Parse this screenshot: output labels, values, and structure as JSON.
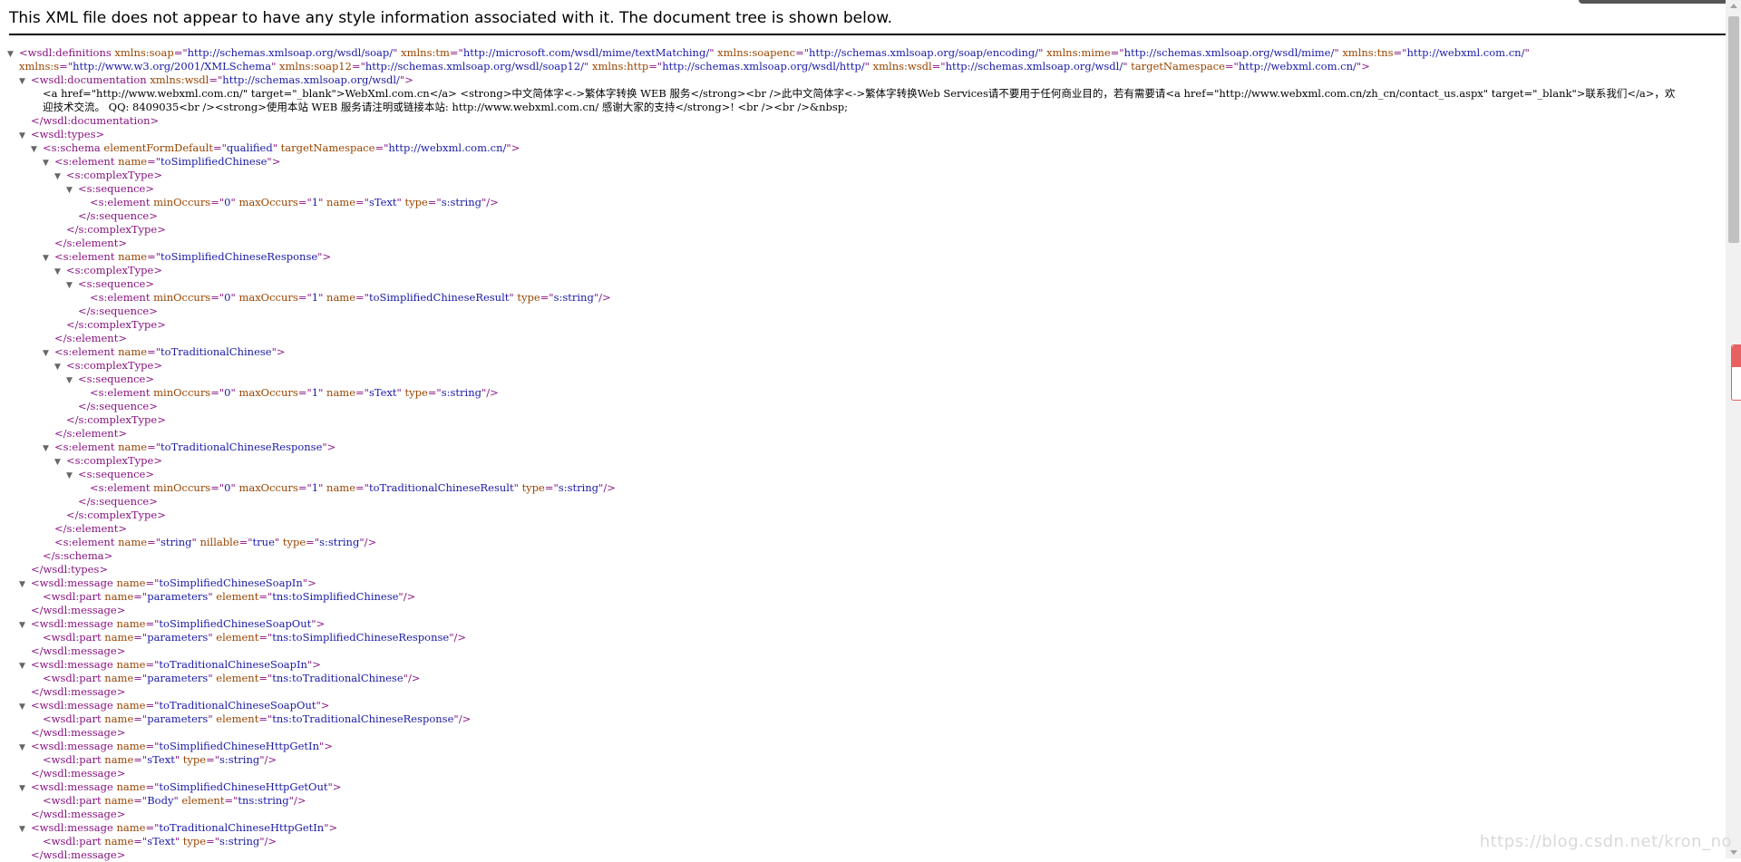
{
  "notice": "This XML file does not appear to have any style information associated with it. The document tree is shown below.",
  "watermark": "https://blog.csdn.net/kron_no",
  "colors": {
    "tag": "#881280",
    "attribute_name": "#994500",
    "attribute_value": "#1a1aa6"
  },
  "lines": [
    {
      "i": 0,
      "t": "open",
      "n": "wsdl:definitions",
      "a": [
        [
          "xmlns:soap",
          "http://schemas.xmlsoap.org/wsdl/soap/"
        ],
        [
          "xmlns:tm",
          "http://microsoft.com/wsdl/mime/textMatching/"
        ],
        [
          "xmlns:soapenc",
          "http://schemas.xmlsoap.org/soap/encoding/"
        ],
        [
          "xmlns:mime",
          "http://schemas.xmlsoap.org/wsdl/mime/"
        ],
        [
          "xmlns:tns",
          "http://webxml.com.cn/"
        ]
      ],
      "end": ""
    },
    {
      "i": 0,
      "t": "cont",
      "a": [
        [
          "xmlns:s",
          "http://www.w3.org/2001/XMLSchema"
        ],
        [
          "xmlns:soap12",
          "http://schemas.xmlsoap.org/wsdl/soap12/"
        ],
        [
          "xmlns:http",
          "http://schemas.xmlsoap.org/wsdl/http/"
        ],
        [
          "xmlns:wsdl",
          "http://schemas.xmlsoap.org/wsdl/"
        ],
        [
          "targetNamespace",
          "http://webxml.com.cn/"
        ]
      ],
      "end": ">"
    },
    {
      "i": 1,
      "t": "open",
      "n": "wsdl:documentation",
      "a": [
        [
          "xmlns:wsdl",
          "http://schemas.xmlsoap.org/wsdl/"
        ]
      ]
    },
    {
      "i": 2,
      "t": "text",
      "x": "<a href=\"http://www.webxml.com.cn/\" target=\"_blank\">WebXml.com.cn</a> <strong>中文简体字<->繁体字转换 WEB 服务</strong><br />此中文简体字<->繁体字转换Web Services请不要用于任何商业目的，若有需要请<a href=\"http://www.webxml.com.cn/zh_cn/contact_us.aspx\" target=\"_blank\">联系我们</a>，欢"
    },
    {
      "i": 2,
      "t": "text",
      "x": "迎技术交流。 QQ: 8409035<br /><strong>使用本站 WEB 服务请注明或链接本站: http://www.webxml.com.cn/ 感谢大家的支持</strong>! <br /><br />&nbsp;"
    },
    {
      "i": 1,
      "t": "close",
      "n": "wsdl:documentation"
    },
    {
      "i": 1,
      "t": "open",
      "n": "wsdl:types",
      "a": []
    },
    {
      "i": 2,
      "t": "open",
      "n": "s:schema",
      "a": [
        [
          "elementFormDefault",
          "qualified"
        ],
        [
          "targetNamespace",
          "http://webxml.com.cn/"
        ]
      ]
    },
    {
      "i": 3,
      "t": "open",
      "n": "s:element",
      "a": [
        [
          "name",
          "toSimplifiedChinese"
        ]
      ]
    },
    {
      "i": 4,
      "t": "open",
      "n": "s:complexType",
      "a": []
    },
    {
      "i": 5,
      "t": "open",
      "n": "s:sequence",
      "a": []
    },
    {
      "i": 6,
      "t": "self",
      "n": "s:element",
      "a": [
        [
          "minOccurs",
          "0"
        ],
        [
          "maxOccurs",
          "1"
        ],
        [
          "name",
          "sText"
        ],
        [
          "type",
          "s:string"
        ]
      ]
    },
    {
      "i": 5,
      "t": "close",
      "n": "s:sequence"
    },
    {
      "i": 4,
      "t": "close",
      "n": "s:complexType"
    },
    {
      "i": 3,
      "t": "close",
      "n": "s:element"
    },
    {
      "i": 3,
      "t": "open",
      "n": "s:element",
      "a": [
        [
          "name",
          "toSimplifiedChineseResponse"
        ]
      ]
    },
    {
      "i": 4,
      "t": "open",
      "n": "s:complexType",
      "a": []
    },
    {
      "i": 5,
      "t": "open",
      "n": "s:sequence",
      "a": []
    },
    {
      "i": 6,
      "t": "self",
      "n": "s:element",
      "a": [
        [
          "minOccurs",
          "0"
        ],
        [
          "maxOccurs",
          "1"
        ],
        [
          "name",
          "toSimplifiedChineseResult"
        ],
        [
          "type",
          "s:string"
        ]
      ]
    },
    {
      "i": 5,
      "t": "close",
      "n": "s:sequence"
    },
    {
      "i": 4,
      "t": "close",
      "n": "s:complexType"
    },
    {
      "i": 3,
      "t": "close",
      "n": "s:element"
    },
    {
      "i": 3,
      "t": "open",
      "n": "s:element",
      "a": [
        [
          "name",
          "toTraditionalChinese"
        ]
      ]
    },
    {
      "i": 4,
      "t": "open",
      "n": "s:complexType",
      "a": []
    },
    {
      "i": 5,
      "t": "open",
      "n": "s:sequence",
      "a": []
    },
    {
      "i": 6,
      "t": "self",
      "n": "s:element",
      "a": [
        [
          "minOccurs",
          "0"
        ],
        [
          "maxOccurs",
          "1"
        ],
        [
          "name",
          "sText"
        ],
        [
          "type",
          "s:string"
        ]
      ]
    },
    {
      "i": 5,
      "t": "close",
      "n": "s:sequence"
    },
    {
      "i": 4,
      "t": "close",
      "n": "s:complexType"
    },
    {
      "i": 3,
      "t": "close",
      "n": "s:element"
    },
    {
      "i": 3,
      "t": "open",
      "n": "s:element",
      "a": [
        [
          "name",
          "toTraditionalChineseResponse"
        ]
      ]
    },
    {
      "i": 4,
      "t": "open",
      "n": "s:complexType",
      "a": []
    },
    {
      "i": 5,
      "t": "open",
      "n": "s:sequence",
      "a": []
    },
    {
      "i": 6,
      "t": "self",
      "n": "s:element",
      "a": [
        [
          "minOccurs",
          "0"
        ],
        [
          "maxOccurs",
          "1"
        ],
        [
          "name",
          "toTraditionalChineseResult"
        ],
        [
          "type",
          "s:string"
        ]
      ]
    },
    {
      "i": 5,
      "t": "close",
      "n": "s:sequence"
    },
    {
      "i": 4,
      "t": "close",
      "n": "s:complexType"
    },
    {
      "i": 3,
      "t": "close",
      "n": "s:element"
    },
    {
      "i": 3,
      "t": "self",
      "n": "s:element",
      "a": [
        [
          "name",
          "string"
        ],
        [
          "nillable",
          "true"
        ],
        [
          "type",
          "s:string"
        ]
      ]
    },
    {
      "i": 2,
      "t": "close",
      "n": "s:schema"
    },
    {
      "i": 1,
      "t": "close",
      "n": "wsdl:types"
    },
    {
      "i": 1,
      "t": "open",
      "n": "wsdl:message",
      "a": [
        [
          "name",
          "toSimplifiedChineseSoapIn"
        ]
      ]
    },
    {
      "i": 2,
      "t": "self",
      "n": "wsdl:part",
      "a": [
        [
          "name",
          "parameters"
        ],
        [
          "element",
          "tns:toSimplifiedChinese"
        ]
      ]
    },
    {
      "i": 1,
      "t": "close",
      "n": "wsdl:message"
    },
    {
      "i": 1,
      "t": "open",
      "n": "wsdl:message",
      "a": [
        [
          "name",
          "toSimplifiedChineseSoapOut"
        ]
      ]
    },
    {
      "i": 2,
      "t": "self",
      "n": "wsdl:part",
      "a": [
        [
          "name",
          "parameters"
        ],
        [
          "element",
          "tns:toSimplifiedChineseResponse"
        ]
      ]
    },
    {
      "i": 1,
      "t": "close",
      "n": "wsdl:message"
    },
    {
      "i": 1,
      "t": "open",
      "n": "wsdl:message",
      "a": [
        [
          "name",
          "toTraditionalChineseSoapIn"
        ]
      ]
    },
    {
      "i": 2,
      "t": "self",
      "n": "wsdl:part",
      "a": [
        [
          "name",
          "parameters"
        ],
        [
          "element",
          "tns:toTraditionalChinese"
        ]
      ]
    },
    {
      "i": 1,
      "t": "close",
      "n": "wsdl:message"
    },
    {
      "i": 1,
      "t": "open",
      "n": "wsdl:message",
      "a": [
        [
          "name",
          "toTraditionalChineseSoapOut"
        ]
      ]
    },
    {
      "i": 2,
      "t": "self",
      "n": "wsdl:part",
      "a": [
        [
          "name",
          "parameters"
        ],
        [
          "element",
          "tns:toTraditionalChineseResponse"
        ]
      ]
    },
    {
      "i": 1,
      "t": "close",
      "n": "wsdl:message"
    },
    {
      "i": 1,
      "t": "open",
      "n": "wsdl:message",
      "a": [
        [
          "name",
          "toSimplifiedChineseHttpGetIn"
        ]
      ]
    },
    {
      "i": 2,
      "t": "self",
      "n": "wsdl:part",
      "a": [
        [
          "name",
          "sText"
        ],
        [
          "type",
          "s:string"
        ]
      ]
    },
    {
      "i": 1,
      "t": "close",
      "n": "wsdl:message"
    },
    {
      "i": 1,
      "t": "open",
      "n": "wsdl:message",
      "a": [
        [
          "name",
          "toSimplifiedChineseHttpGetOut"
        ]
      ]
    },
    {
      "i": 2,
      "t": "self",
      "n": "wsdl:part",
      "a": [
        [
          "name",
          "Body"
        ],
        [
          "element",
          "tns:string"
        ]
      ]
    },
    {
      "i": 1,
      "t": "close",
      "n": "wsdl:message"
    },
    {
      "i": 1,
      "t": "open",
      "n": "wsdl:message",
      "a": [
        [
          "name",
          "toTraditionalChineseHttpGetIn"
        ]
      ]
    },
    {
      "i": 2,
      "t": "self",
      "n": "wsdl:part",
      "a": [
        [
          "name",
          "sText"
        ],
        [
          "type",
          "s:string"
        ]
      ]
    },
    {
      "i": 1,
      "t": "close",
      "n": "wsdl:message"
    }
  ]
}
